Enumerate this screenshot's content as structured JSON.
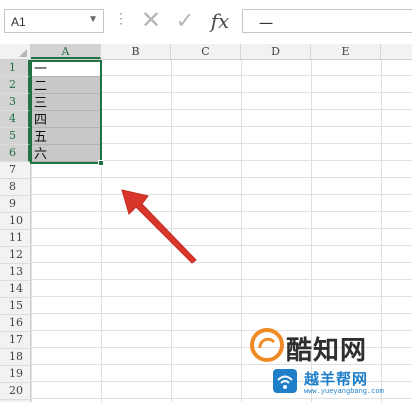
{
  "formula_bar": {
    "name_box": "A1",
    "dots": "⋮",
    "cancel_glyph": "✕",
    "enter_glyph": "✓",
    "fx_label": "fx",
    "value": "一"
  },
  "columns": [
    "A",
    "B",
    "C",
    "D",
    "E"
  ],
  "rows": [
    "1",
    "2",
    "3",
    "4",
    "5",
    "6",
    "7",
    "8",
    "9",
    "10",
    "11",
    "12",
    "13",
    "14",
    "15",
    "16",
    "17",
    "18",
    "19",
    "20"
  ],
  "cells_a": [
    "一",
    "二",
    "三",
    "四",
    "五",
    "六"
  ],
  "watermark": {
    "title_a": "酷知网",
    "title_b": "越羊帮网",
    "url": "www.yueyangbang.com"
  },
  "colors": {
    "selection": "#217346",
    "arrow": "#d9362b",
    "watermark_blue": "#1f7fc9"
  }
}
